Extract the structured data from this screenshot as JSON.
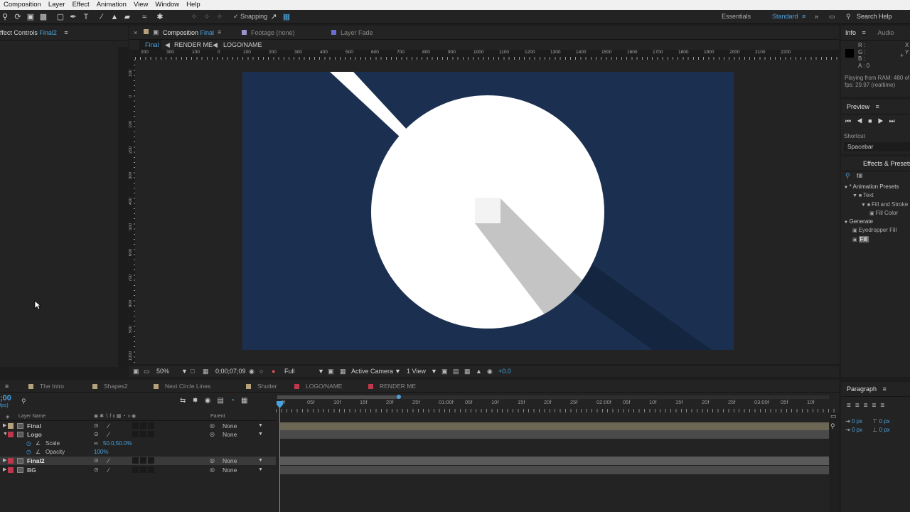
{
  "menu": [
    "Composition",
    "Layer",
    "Effect",
    "Animation",
    "View",
    "Window",
    "Help"
  ],
  "toolbar": {
    "snapping": "Snapping",
    "ws_essentials": "Essentials",
    "ws_standard": "Standard",
    "search_help": "Search Help"
  },
  "effect_controls": {
    "title": "ffect Controls",
    "layer": "Final2"
  },
  "comp_header": {
    "title": "Composition",
    "name": "Final",
    "footage": "Footage (none)",
    "layer": "Layer Fade"
  },
  "breadcrumbs": [
    "Final",
    "RENDER ME",
    "LOGO/NAME"
  ],
  "ruler_top": [
    "200",
    "300",
    "100",
    "0",
    "100",
    "200",
    "300",
    "400",
    "500",
    "600",
    "700",
    "800",
    "900",
    "1000",
    "1100",
    "1200",
    "1300",
    "1400",
    "1500",
    "1600",
    "1700",
    "1800",
    "1900",
    "2000",
    "2100",
    "2200"
  ],
  "ruler_left": [
    "100",
    "0",
    "100",
    "200",
    "300",
    "400",
    "500",
    "600",
    "700",
    "800",
    "900",
    "1000"
  ],
  "viewer_bar": {
    "zoom": "50%",
    "timecode": "0;00;07;09",
    "resolution": "Full",
    "camera": "Active Camera",
    "views": "1 View",
    "exposure": "+0.0"
  },
  "info": {
    "tab": "Info",
    "tab2": "Audio",
    "r": "R :",
    "g": "G :",
    "b": "B :",
    "a": "A : 0",
    "x": "X",
    "y": "Y",
    "playing": "Playing from RAM: 480 of",
    "fps": "fps: 29.97 (realtime)"
  },
  "preview": {
    "title": "Preview",
    "shortcut_label": "Shortcut",
    "shortcut": "Spacebar"
  },
  "effects": {
    "title": "Effects & Presets",
    "search": "fill",
    "items": [
      {
        "label": "* Animation Presets",
        "indent": 0,
        "type": "cat"
      },
      {
        "label": "Text",
        "indent": 1,
        "type": "folder"
      },
      {
        "label": "Fill and Stroke",
        "indent": 2,
        "type": "folder"
      },
      {
        "label": "Fill Color",
        "indent": 3,
        "type": "file"
      },
      {
        "label": "Generate",
        "indent": 0,
        "type": "cat"
      },
      {
        "label": "Eyedropper Fill",
        "indent": 1,
        "type": "file"
      },
      {
        "label": "Fill",
        "indent": 1,
        "type": "file",
        "selected": true
      }
    ]
  },
  "paragraph": {
    "title": "Paragraph",
    "px1": "0 px",
    "px2": "0 px",
    "px3": "0 px",
    "px4": "0 px"
  },
  "timeline": {
    "tabs": [
      {
        "label": "The Intro",
        "color": "#b6a27a"
      },
      {
        "label": "Shapes2",
        "color": "#b6a27a"
      },
      {
        "label": "Next Circle Lines",
        "color": "#b6a27a"
      },
      {
        "label": "Shutter",
        "color": "#b6a27a"
      },
      {
        "label": "LOGO/NAME",
        "color": "#c0374b"
      },
      {
        "label": "RENDER ME",
        "color": "#c0374b"
      }
    ],
    "timecode": ";00",
    "fps": "fps)",
    "col_layer": "Layer Name",
    "col_parent": "Parent",
    "layers": [
      {
        "name": "Final",
        "color": "#b6a27a",
        "expanded": false,
        "parent": "None"
      },
      {
        "name": "Logo",
        "color": "#c0374b",
        "expanded": true,
        "parent": "None"
      },
      {
        "name": "Final2",
        "color": "#c0374b",
        "expanded": false,
        "parent": "None",
        "selected": true
      },
      {
        "name": "BG",
        "color": "#c0374b",
        "expanded": false,
        "parent": "None"
      }
    ],
    "props": [
      {
        "name": "Scale",
        "value": "50.0,50.0%"
      },
      {
        "name": "Opacity",
        "value": "100%"
      }
    ],
    "ticks": [
      "0f",
      "05f",
      "10f",
      "15f",
      "20f",
      "25f",
      "01:00f",
      "05f",
      "10f",
      "15f",
      "20f",
      "25f",
      "02:00f",
      "05f",
      "10f",
      "15f",
      "20f",
      "25f",
      "03:00f",
      "05f",
      "10f"
    ]
  },
  "colors": {
    "stage": "#1b3050",
    "accent": "#4aa3df",
    "green": "#38c23a"
  }
}
